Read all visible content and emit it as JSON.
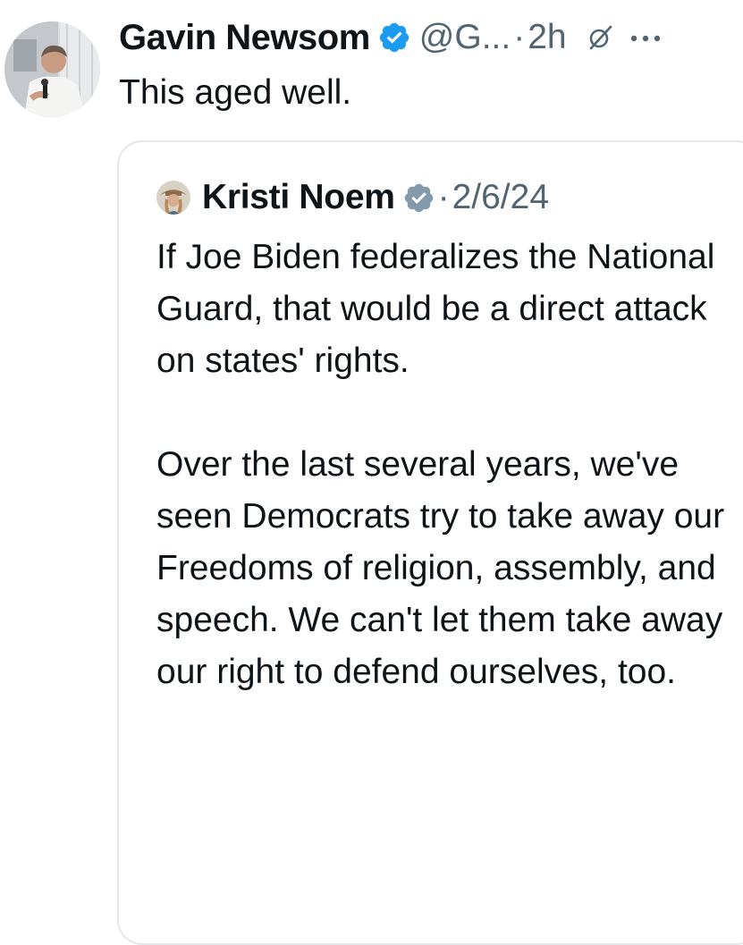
{
  "post": {
    "author_name": "Gavin Newsom",
    "handle": "@G...",
    "separator": "·",
    "time": "2h",
    "text": "This aged well.",
    "avatar_icon": "profile-photo",
    "verified_icon": "verified-badge-icon",
    "verified_color": "#1d9bf0",
    "action_icons": [
      "grok-icon",
      "more-options-icon"
    ]
  },
  "quote": {
    "author_name": "Kristi Noem",
    "separator": "·",
    "date": "2/6/24",
    "verified_icon": "verified-badge-icon",
    "verified_color": "#829aab",
    "paragraphs": [
      "If Joe Biden federalizes the National Guard, that would be a direct attack on states' rights.",
      "Over the last several years, we've seen Democrats try to take away our Freedoms of religion, assembly, and speech. We can't let them take away our right to defend ourselves, too."
    ]
  },
  "colors": {
    "text": "#0f1419",
    "secondary_text": "#536471",
    "card_border": "#e3e7ea"
  }
}
